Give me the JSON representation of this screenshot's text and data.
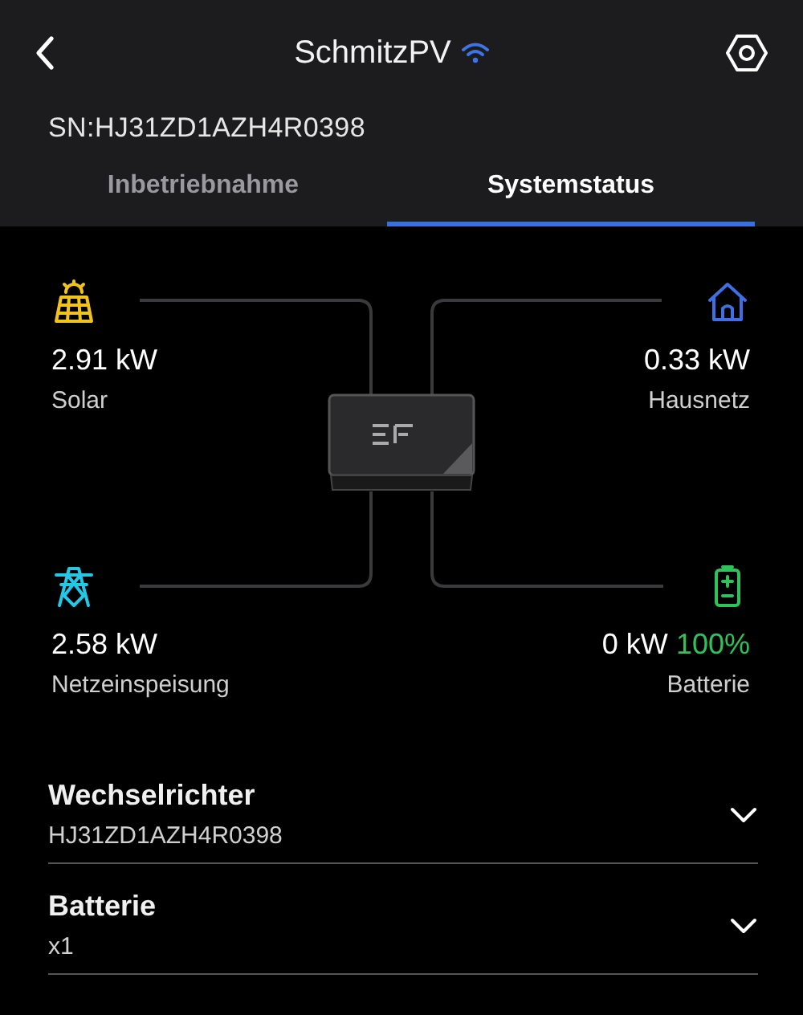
{
  "header": {
    "title": "SchmitzPV",
    "serial": "SN:HJ31ZD1AZH4R0398"
  },
  "tabs": [
    {
      "label": "Inbetriebnahme",
      "selected": false
    },
    {
      "label": "Systemstatus",
      "selected": true
    }
  ],
  "nodes": [
    {
      "kind": "solar",
      "color": "#f2c31a",
      "value": "2.91 kW",
      "label": "Solar"
    },
    {
      "kind": "home",
      "color": "#3f6fe4",
      "value": "0.33 kW",
      "label": "Hausnetz"
    },
    {
      "kind": "grid",
      "color": "#22c8e6",
      "value": "2.58 kW",
      "label": "Netzeinspeisung"
    },
    {
      "kind": "battery",
      "color": "#2fc25a",
      "value": "0 kW",
      "percent": "100%",
      "label": "Batterie"
    }
  ],
  "devices": [
    {
      "title": "Wechselrichter",
      "detail": "HJ31ZD1AZH4R0398",
      "expanded": false
    },
    {
      "title": "Batterie",
      "detail": "x1",
      "expanded": false
    }
  ]
}
